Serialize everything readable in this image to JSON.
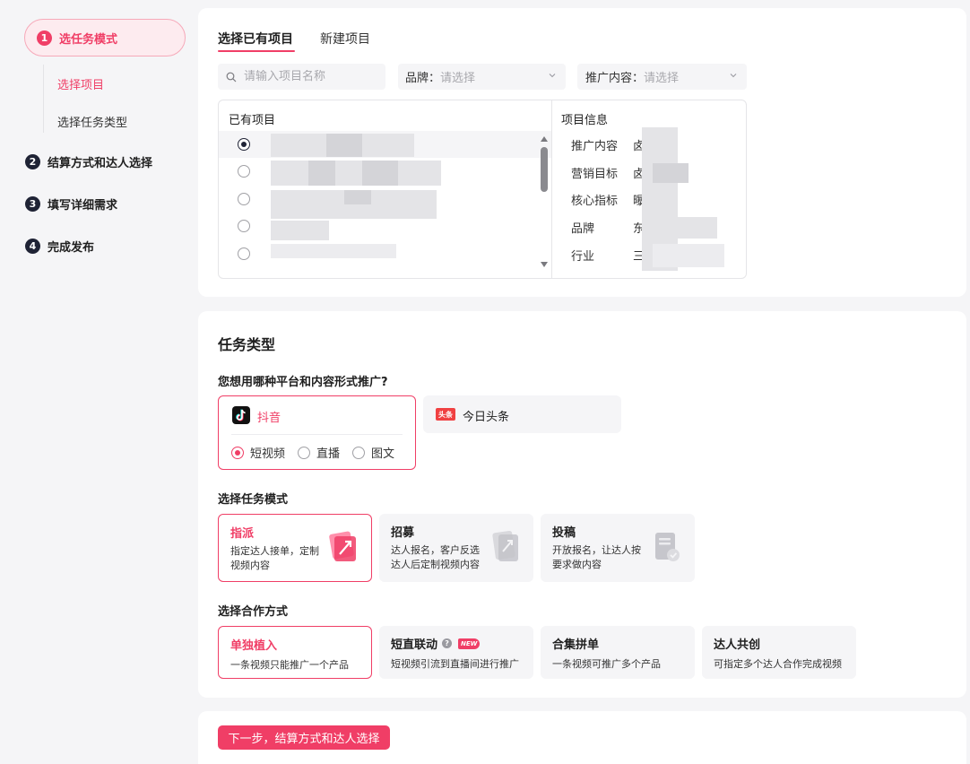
{
  "sidebar": {
    "steps": [
      {
        "num": "1",
        "label": "选任务模式"
      },
      {
        "num": "2",
        "label": "结算方式和达人选择"
      },
      {
        "num": "3",
        "label": "填写详细需求"
      },
      {
        "num": "4",
        "label": "完成发布"
      }
    ],
    "substeps": [
      "选择项目",
      "选择任务类型"
    ]
  },
  "project": {
    "tabs": [
      "选择已有项目",
      "新建项目"
    ],
    "search_placeholder": "请输入项目名称",
    "brand_filter": {
      "label": "品牌：",
      "placeholder": "请选择"
    },
    "content_filter": {
      "label": "推广内容：",
      "placeholder": "请选择"
    },
    "list_header": "已有项目",
    "info_header": "项目信息",
    "info_labels": [
      "推广内容",
      "营销目标",
      "核心指标",
      "品牌",
      "行业"
    ],
    "info_values": [
      "卤",
      "卤",
      "曝",
      "东",
      "三"
    ]
  },
  "task": {
    "title": "任务类型",
    "platform_question": "您想用哪种平台和内容形式推广?",
    "platforms": [
      {
        "name": "抖音",
        "logo_icon": "douyin-logo-icon"
      },
      {
        "name": "今日头条",
        "logo_icon": "toutiao-logo-icon",
        "logo_text": "头条"
      }
    ],
    "formats": [
      "短视频",
      "直播",
      "图文"
    ],
    "mode_title": "选择任务模式",
    "modes": [
      {
        "name": "指派",
        "desc": "指定达人接单，定制视频内容"
      },
      {
        "name": "招募",
        "desc": "达人报名，客户反选达人后定制视频内容"
      },
      {
        "name": "投稿",
        "desc": "开放报名，让达人按要求做内容"
      }
    ],
    "coop_title": "选择合作方式",
    "coops": [
      {
        "name": "单独植入",
        "desc": "一条视频只能推广一个产品"
      },
      {
        "name": "短直联动",
        "desc": "短视频引流到直播间进行推广",
        "help": "?",
        "badge": "NEW"
      },
      {
        "name": "合集拼单",
        "desc": "一条视频可推广多个产品"
      },
      {
        "name": "达人共创",
        "desc": "可指定多个达人合作完成视频"
      }
    ]
  },
  "next_button": "下一步，结算方式和达人选择",
  "colors": {
    "accent": "#f03e66",
    "dark": "#1f2335",
    "bg": "#f5f5f7"
  }
}
